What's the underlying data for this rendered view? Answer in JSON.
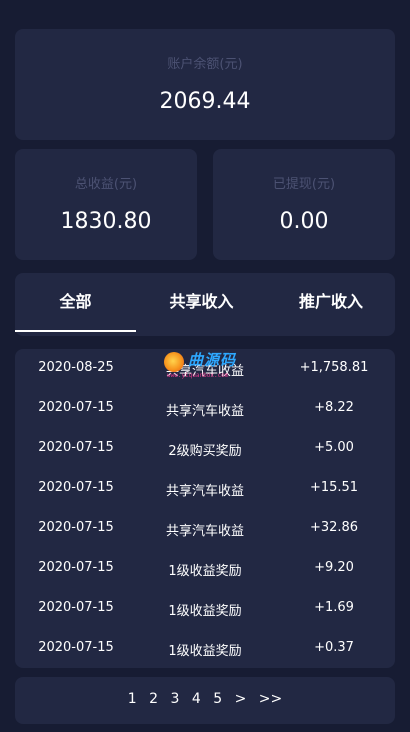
{
  "balance": {
    "label": "账户余额(元)",
    "value": "2069.44"
  },
  "stats": {
    "total_earnings": {
      "label": "总收益(元)",
      "value": "1830.80"
    },
    "withdrawn": {
      "label": "已提现(元)",
      "value": "0.00"
    }
  },
  "tabs": [
    {
      "label": "全部",
      "active": true
    },
    {
      "label": "共享收入",
      "active": false
    },
    {
      "label": "推广收入",
      "active": false
    }
  ],
  "records": [
    {
      "date": "2020-08-25",
      "type": "共享汽车收益",
      "amount": "+1,758.81"
    },
    {
      "date": "2020-07-15",
      "type": "共享汽车收益",
      "amount": "+8.22"
    },
    {
      "date": "2020-07-15",
      "type": "2级购买奖励",
      "amount": "+5.00"
    },
    {
      "date": "2020-07-15",
      "type": "共享汽车收益",
      "amount": "+15.51"
    },
    {
      "date": "2020-07-15",
      "type": "共享汽车收益",
      "amount": "+32.86"
    },
    {
      "date": "2020-07-15",
      "type": "1级收益奖励",
      "amount": "+9.20"
    },
    {
      "date": "2020-07-15",
      "type": "1级收益奖励",
      "amount": "+1.69"
    },
    {
      "date": "2020-07-15",
      "type": "1级收益奖励",
      "amount": "+0.37"
    }
  ],
  "watermark": {
    "text": "曲源码",
    "url": "www.yiquanbox.com"
  },
  "pagination": {
    "pages": [
      "1",
      "2",
      "3",
      "4",
      "5"
    ],
    "next": ">",
    "last": ">>"
  }
}
